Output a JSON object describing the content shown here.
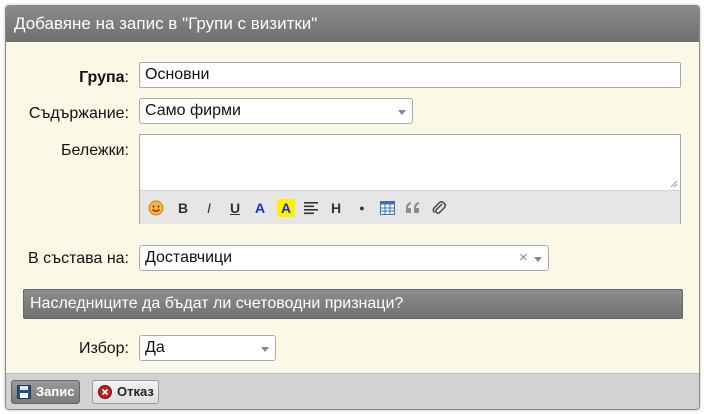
{
  "dialog": {
    "title": "Добавяне на запис в \"Групи с визитки\""
  },
  "form": {
    "group_label": "Група",
    "group_colon": ":",
    "group_value": "Основни",
    "content_label": "Съдържание:",
    "content_value": "Само фирми",
    "notes_label": "Бележки:",
    "notes_value": "",
    "part_of_label": "В състава на:",
    "part_of_value": "Доставчици",
    "part_of_clear": "×",
    "section_title": "Наследниците да бъдат ли счетоводни признаци?",
    "choice_label": "Избор:",
    "choice_value": "Да"
  },
  "toolbar": {
    "bold": "B",
    "italic": "I",
    "underline": "U",
    "font_color": "A",
    "highlight": "A",
    "heading": "H",
    "bullet": "●"
  },
  "footer": {
    "save_label": "Запис",
    "cancel_label": "Отказ"
  },
  "colors": {
    "titlebar": "#7c7c7c",
    "body_background": "#fbf9e6",
    "font_color_icon": "#1a2fd6",
    "highlight_icon_bg": "#fff100"
  },
  "icons": {
    "smiley": "smiley-icon",
    "align": "align-justify-icon",
    "table": "table-icon",
    "quote": "quote-icon",
    "attach": "paperclip-icon",
    "save": "floppy-disk-icon",
    "cancel": "close-circle-icon"
  }
}
